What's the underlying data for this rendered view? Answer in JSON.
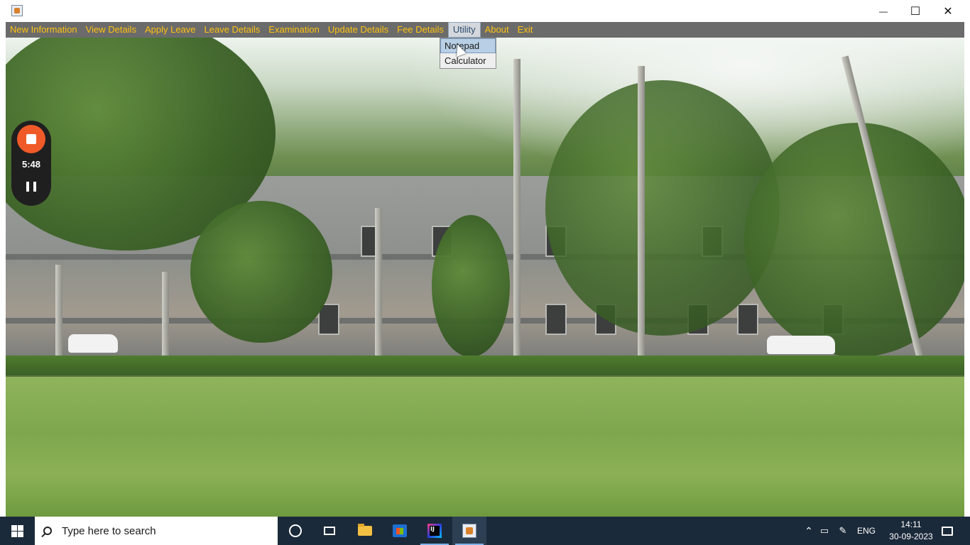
{
  "window": {
    "close_glyph": "✕",
    "maximize_glyph": "☐",
    "minimize_glyph": "—"
  },
  "menubar": {
    "items": [
      {
        "label": "New Information"
      },
      {
        "label": "View Details"
      },
      {
        "label": "Apply Leave"
      },
      {
        "label": "Leave Details"
      },
      {
        "label": "Examination"
      },
      {
        "label": "Update Details"
      },
      {
        "label": "Fee Details"
      },
      {
        "label": "Utility"
      },
      {
        "label": "About"
      },
      {
        "label": "Exit"
      }
    ],
    "active": "Utility"
  },
  "utility_menu": {
    "items": [
      {
        "label": "Notepad"
      },
      {
        "label": "Calculator"
      }
    ],
    "hovered": "Notepad"
  },
  "recorder": {
    "time": "5:48"
  },
  "taskbar": {
    "search_placeholder": "Type here to search",
    "language": "ENG",
    "time": "14:11",
    "date": "30-09-2023"
  },
  "colors": {
    "menu_text": "#ffc20e",
    "menu_bar": "#6b6b6b",
    "recorder_button": "#f05a28",
    "taskbar": "#1b2a3a"
  }
}
